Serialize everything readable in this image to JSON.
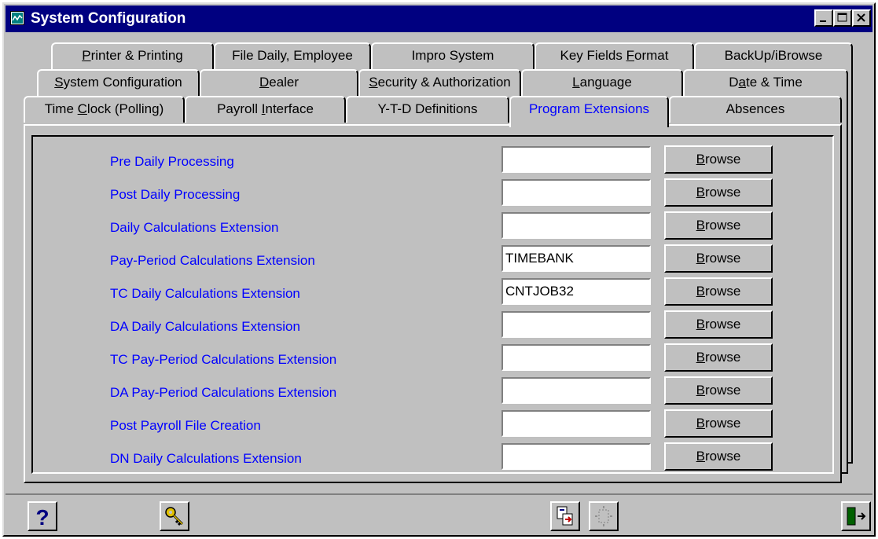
{
  "window": {
    "title": "System Configuration"
  },
  "tabs_row1": [
    {
      "pre": "",
      "u": "P",
      "post": "rinter & Printing"
    },
    {
      "pre": "File Daily, Employee",
      "u": "",
      "post": ""
    },
    {
      "pre": "Impro System",
      "u": "",
      "post": ""
    },
    {
      "pre": "Key Fields ",
      "u": "F",
      "post": "ormat"
    },
    {
      "pre": "BackUp/iBrowse",
      "u": "",
      "post": ""
    }
  ],
  "tabs_row2": [
    {
      "pre": "",
      "u": "S",
      "post": "ystem Configuration"
    },
    {
      "pre": "",
      "u": "D",
      "post": "ealer"
    },
    {
      "pre": "",
      "u": "S",
      "post": "ecurity & Authorization"
    },
    {
      "pre": "",
      "u": "L",
      "post": "anguage"
    },
    {
      "pre": "D",
      "u": "a",
      "post": "te & Time"
    }
  ],
  "tabs_row3": [
    {
      "pre": "Time ",
      "u": "C",
      "post": "lock (Polling)"
    },
    {
      "pre": "Payroll ",
      "u": "I",
      "post": "nterface"
    },
    {
      "pre": "Y-T-D Definitions",
      "u": "",
      "post": ""
    },
    {
      "pre": "Program Extensions",
      "u": "",
      "post": ""
    },
    {
      "pre": "Absences",
      "u": "",
      "post": ""
    }
  ],
  "extensions": [
    {
      "label": "Pre  Daily Processing",
      "value": ""
    },
    {
      "label": "Post Daily Processing",
      "value": ""
    },
    {
      "label": "Daily Calculations Extension",
      "value": ""
    },
    {
      "label": "Pay-Period Calculations Extension",
      "value": "TIMEBANK"
    },
    {
      "label": "TC Daily Calculations Extension",
      "value": "CNTJOB32"
    },
    {
      "label": "DA Daily Calculations Extension",
      "value": ""
    },
    {
      "label": "TC Pay-Period Calculations Extension",
      "value": ""
    },
    {
      "label": "DA Pay-Period Calculations Extension",
      "value": ""
    },
    {
      "label": "Post Payroll File Creation",
      "value": ""
    },
    {
      "label": "DN Daily Calculations Extension",
      "value": ""
    }
  ],
  "browse": {
    "u": "B",
    "post": "rowse"
  },
  "toolbar": {
    "help_icon": "question-mark-icon",
    "key_icon": "key-icon",
    "export_icon": "copy-to-icon",
    "disabled_icon": "disabled-action-icon",
    "exit_icon": "exit-door-icon"
  }
}
